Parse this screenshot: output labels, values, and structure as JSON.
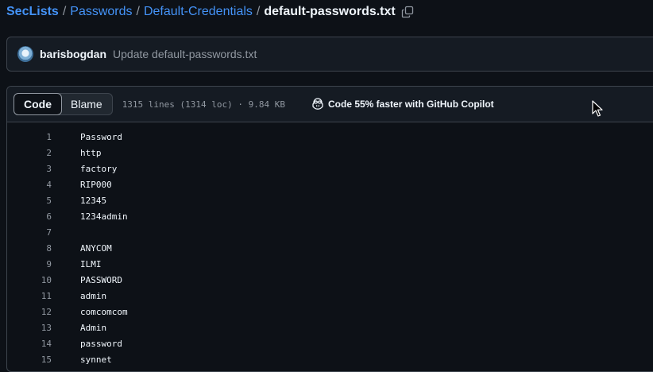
{
  "breadcrumb": {
    "items": [
      "SecLists",
      "Passwords",
      "Default-Credentials"
    ],
    "current": "default-passwords.txt",
    "separator": "/"
  },
  "icons": {
    "copy": "copy-icon",
    "copilot": "copilot-icon",
    "cursor": "mouse-pointer-icon"
  },
  "commit": {
    "author": "barisbogdan",
    "message": "Update default-passwords.txt"
  },
  "file_header": {
    "tabs": [
      "Code",
      "Blame"
    ],
    "active_tab": "Code",
    "meta": "1315 lines (1314 loc) · 9.84 KB",
    "copilot_text": "Code 55% faster with GitHub Copilot"
  },
  "code_lines": [
    {
      "num": "1",
      "text": "Password"
    },
    {
      "num": "2",
      "text": "http"
    },
    {
      "num": "3",
      "text": "factory"
    },
    {
      "num": "4",
      "text": "RIP000"
    },
    {
      "num": "5",
      "text": "12345"
    },
    {
      "num": "6",
      "text": "1234admin"
    },
    {
      "num": "7",
      "text": ""
    },
    {
      "num": "8",
      "text": "ANYCOM"
    },
    {
      "num": "9",
      "text": "ILMI"
    },
    {
      "num": "10",
      "text": "PASSWORD"
    },
    {
      "num": "11",
      "text": "admin"
    },
    {
      "num": "12",
      "text": "comcomcom"
    },
    {
      "num": "13",
      "text": "Admin"
    },
    {
      "num": "14",
      "text": "password"
    },
    {
      "num": "15",
      "text": "synnet"
    }
  ],
  "colors": {
    "background": "#0d1117",
    "link": "#4493f8",
    "muted": "#9198a1",
    "border": "#3d444d"
  }
}
